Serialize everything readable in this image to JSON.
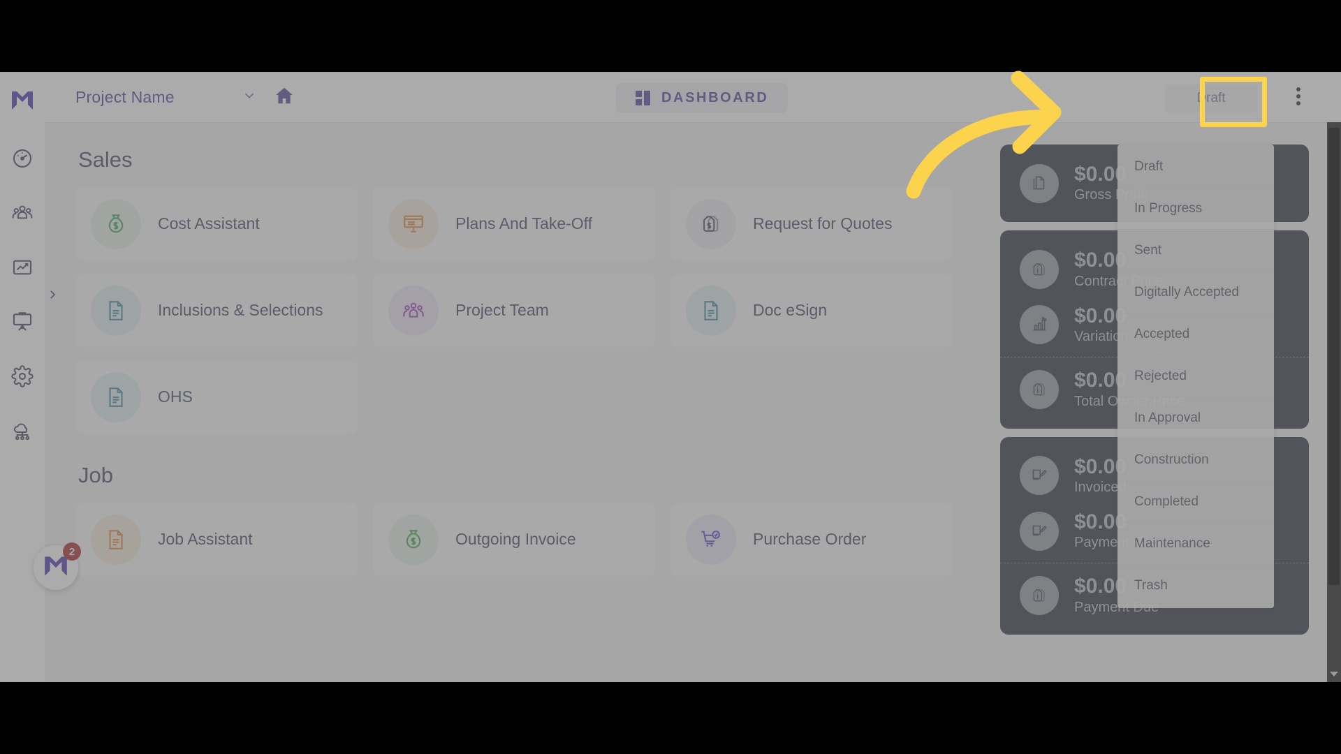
{
  "topbar": {
    "project_selector": {
      "label": "Project Name",
      "chevron_icon": "chevron-down-icon"
    },
    "home_icon": "home-icon",
    "dashboard_tab": {
      "label": "DASHBOARD",
      "icon": "grid-icon"
    },
    "status_chip": {
      "label": "Draft"
    },
    "kebab_icon": "more-vertical-icon"
  },
  "sidebar": {
    "logo_icon": "app-logo-icon",
    "expand_icon": "chevron-right-icon",
    "items": [
      {
        "icon": "speedometer-icon",
        "name": "dashboard"
      },
      {
        "icon": "people-group-icon",
        "name": "team"
      },
      {
        "icon": "chart-line-icon",
        "name": "reports"
      },
      {
        "icon": "presentation-board-icon",
        "name": "presentation"
      },
      {
        "icon": "gear-icon",
        "name": "settings"
      },
      {
        "icon": "cloud-network-icon",
        "name": "integrations"
      }
    ]
  },
  "main": {
    "sections": [
      {
        "title": "Sales",
        "tiles": [
          {
            "label": "Cost Assistant",
            "icon": "money-bag-icon",
            "style": "b-green"
          },
          {
            "label": "Plans And Take-Off",
            "icon": "presentation-board-icon",
            "style": "b-orange"
          },
          {
            "label": "Request for Quotes",
            "icon": "price-tag-dollar-icon",
            "style": "b-grey"
          },
          {
            "label": "Inclusions & Selections",
            "icon": "document-lines-icon",
            "style": "b-teal"
          },
          {
            "label": "Project Team",
            "icon": "people-group-icon",
            "style": "b-purple"
          },
          {
            "label": "Doc eSign",
            "icon": "document-lines-icon",
            "style": "b-teal"
          },
          {
            "label": "OHS",
            "icon": "document-lines-icon",
            "style": "b-teal"
          }
        ]
      },
      {
        "title": "Job",
        "tiles": [
          {
            "label": "Job Assistant",
            "icon": "document-lines-icon",
            "style": "b-orange"
          },
          {
            "label": "Outgoing Invoice",
            "icon": "money-bag-icon",
            "style": "b-green"
          },
          {
            "label": "Purchase Order",
            "icon": "cart-check-icon",
            "style": "b-indigo"
          }
        ]
      }
    ]
  },
  "metrics": {
    "cards": [
      {
        "rows": [
          {
            "value": "$0.00",
            "label": "Gross Profit",
            "icon": "document-copy-icon",
            "dashed": false
          }
        ]
      },
      {
        "rows": [
          {
            "value": "$0.00",
            "label": "Contract Price",
            "icon": "price-tag-dollar-icon",
            "dashed": false
          },
          {
            "value": "$0.00",
            "label": "Variation",
            "icon": "bar-chart-percent-icon",
            "dashed": false
          },
          {
            "value": "$0.00",
            "label": "Total Owner Price",
            "icon": "price-tag-dollar-icon",
            "dashed": true
          }
        ]
      },
      {
        "rows": [
          {
            "value": "$0.00",
            "label": "Invoiced",
            "icon": "invoice-edit-icon",
            "dashed": false
          },
          {
            "value": "$0.00",
            "label": "Payment Received",
            "icon": "invoice-edit-icon",
            "dashed": false
          },
          {
            "value": "$0.00",
            "label": "Payment Due",
            "icon": "price-tag-dollar-icon",
            "dashed": true
          }
        ]
      }
    ]
  },
  "status_dropdown": {
    "options": [
      {
        "label": "Draft"
      },
      {
        "label": "In Progress"
      },
      {
        "label": "Sent"
      },
      {
        "label": "Digitally Accepted"
      },
      {
        "label": "Accepted"
      },
      {
        "label": "Rejected"
      },
      {
        "label": "In Approval"
      },
      {
        "label": "Construction"
      },
      {
        "label": "Completed"
      },
      {
        "label": "Maintenance"
      },
      {
        "label": "Trash"
      }
    ]
  },
  "chat_widget": {
    "badge": "2",
    "icon": "app-logo-icon"
  },
  "annotation": {
    "highlight_color": "#fbd34d",
    "arrow_icon": "curved-arrow-right-icon",
    "target": "Draft"
  },
  "colors": {
    "brand_purple": "#3a2f8f",
    "panel_dark": "#161c2e",
    "accent_yellow": "#fbd34d",
    "badge_red": "#9b1111"
  }
}
